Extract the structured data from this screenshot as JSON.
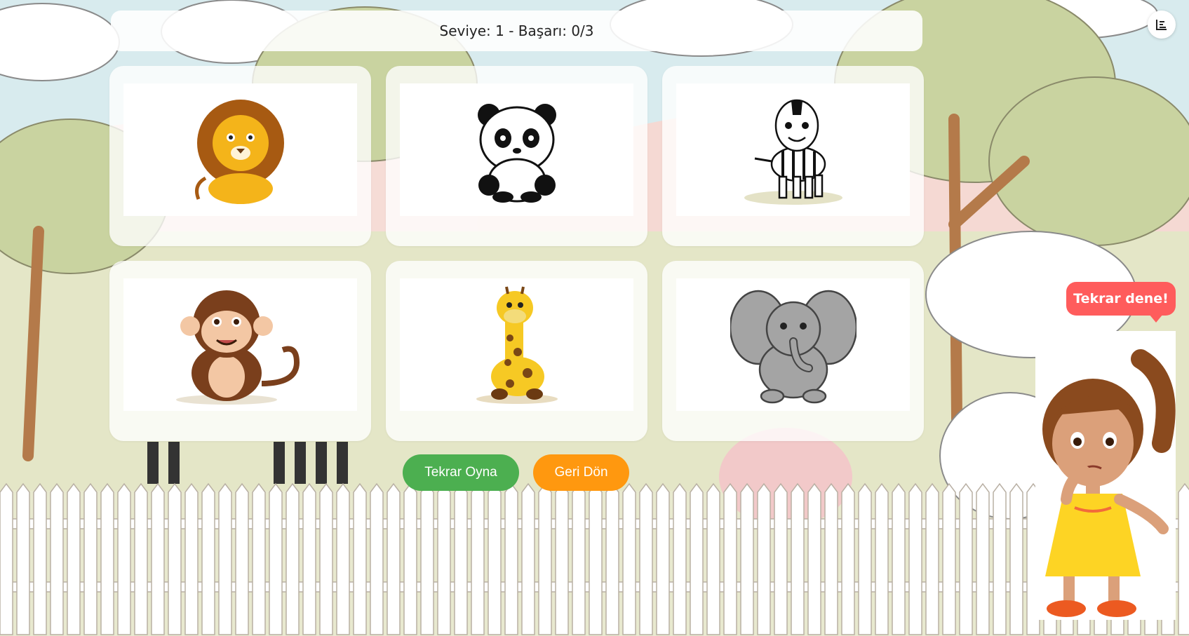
{
  "game": {
    "status_text": "Seviye: 1 - Başarı: 0/3",
    "level": 1,
    "score": 0,
    "target": 3
  },
  "toolbar": {
    "stats_icon": "bar-chart-icon"
  },
  "cards": [
    {
      "animal": "lion"
    },
    {
      "animal": "panda"
    },
    {
      "animal": "zebra"
    },
    {
      "animal": "monkey"
    },
    {
      "animal": "giraffe"
    },
    {
      "animal": "elephant"
    }
  ],
  "buttons": {
    "replay_label": "Tekrar Oyna",
    "back_label": "Geri Dön"
  },
  "feedback": {
    "message": "Tekrar dene!",
    "character": "thinking-girl"
  },
  "colors": {
    "replay": "#4caf50",
    "back": "#ff980f",
    "bubble": "#ff5c5c"
  }
}
